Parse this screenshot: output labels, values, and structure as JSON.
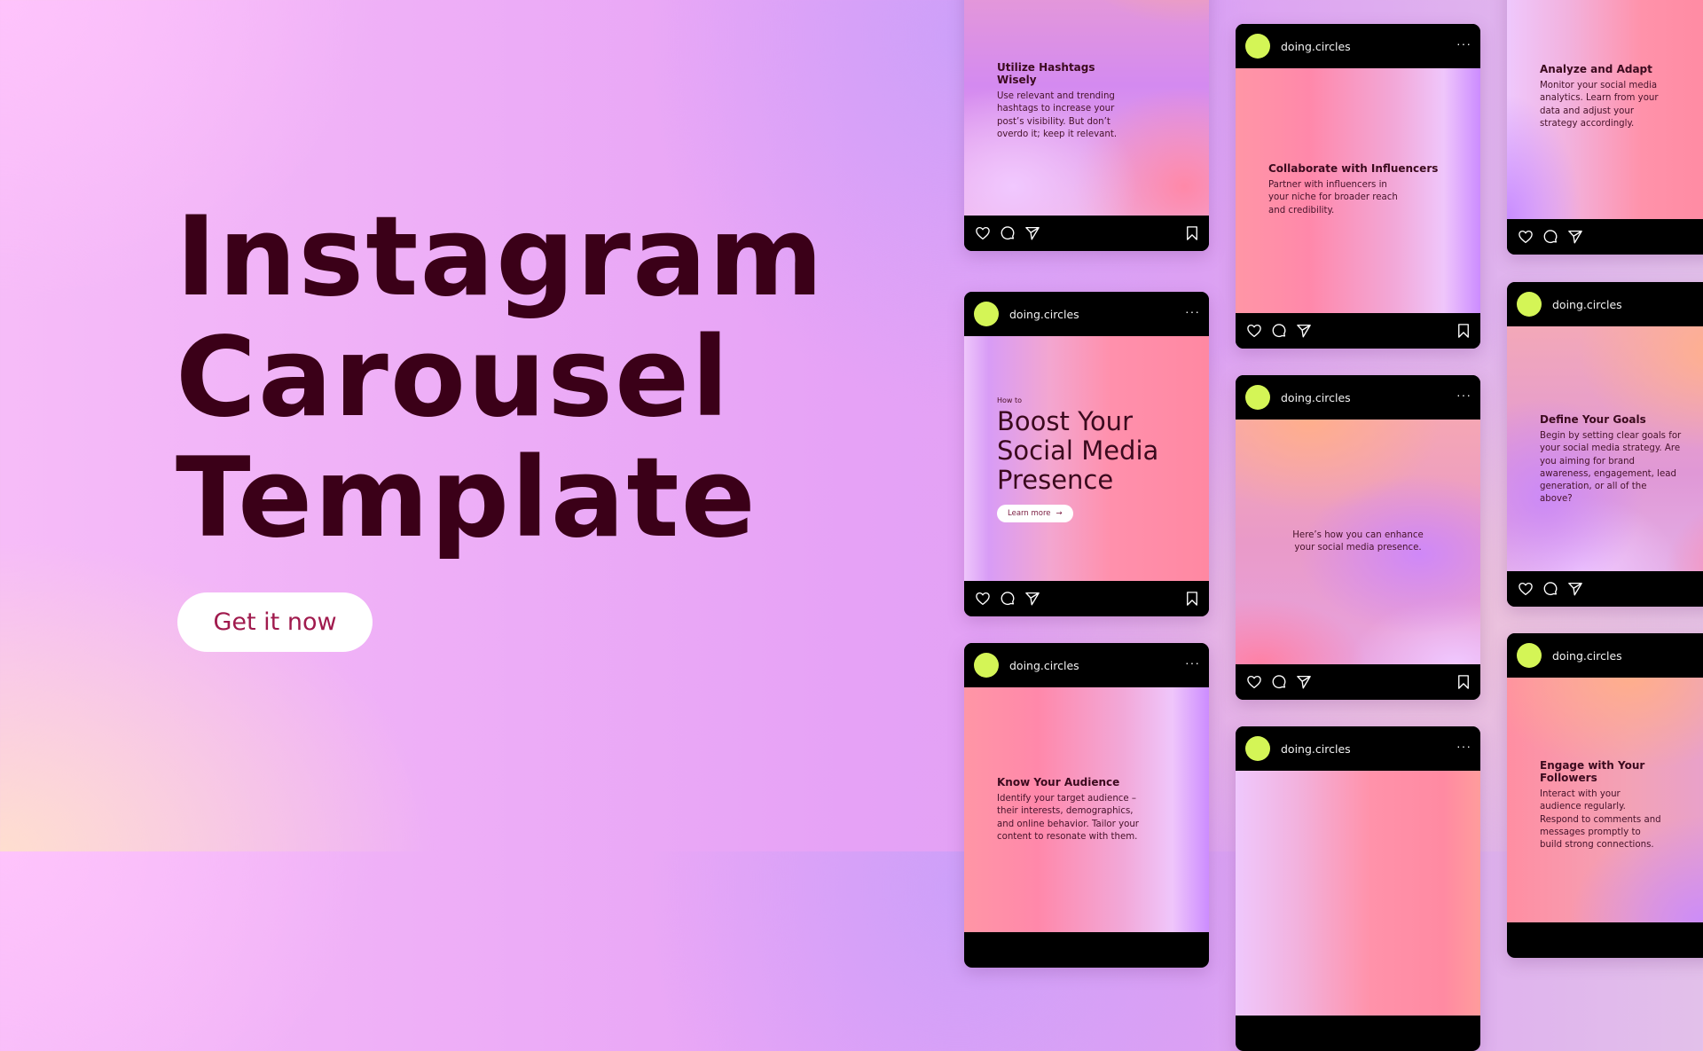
{
  "hero": {
    "title_lines": [
      "Instagram",
      "Carousel",
      "Template"
    ],
    "cta_label": "Get it now"
  },
  "colors": {
    "title": "#3b0018",
    "cta_text": "#a01a4d",
    "avatar": "#d4f556",
    "card_bar": "#000000"
  },
  "account": {
    "username": "doing.circles",
    "more_icon": "···"
  },
  "posts": [
    {
      "title": "Utilize Hashtags Wisely",
      "body": "Use relevant and trending hashtags to increase your post’s visibility. But don’t overdo it; keep it relevant."
    },
    {
      "kicker": "How to",
      "headline_lines": [
        "Boost Your",
        "Social Media",
        "Presence"
      ],
      "button_label": "Learn more",
      "button_icon": "→"
    },
    {
      "title": "Know Your Audience",
      "body": "Identify your target audience – their interests, demographics, and online behavior. Tailor your content to resonate with them."
    },
    {
      "title": "Collaborate with Influencers",
      "body": "Partner with influencers in your niche for broader reach and credibility."
    },
    {
      "body": "Here’s how you can enhance your social media presence."
    },
    {},
    {
      "title": "Analyze and Adapt",
      "body": "Monitor your social media analytics. Learn from your data and adjust your strategy accordingly."
    },
    {
      "title": "Define Your Goals",
      "body": "Begin by setting clear goals for your social media strategy. Are you aiming for brand awareness, engagement, lead generation, or all of the above?"
    },
    {
      "title": "Engage with Your Followers",
      "body": "Interact with your audience regularly. Respond to comments and messages promptly to build strong connections."
    }
  ],
  "icons": {
    "like": "heart-icon",
    "comment": "comment-icon",
    "share": "send-icon",
    "save": "bookmark-icon"
  }
}
